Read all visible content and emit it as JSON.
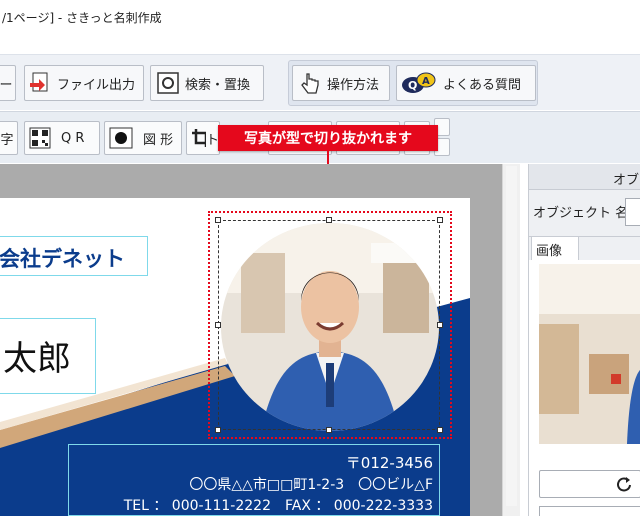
{
  "window": {
    "title": "/1ページ] - さきっと名刺作成"
  },
  "toolbar1": {
    "prev_label": "ー",
    "file_output_label": "ファイル出力",
    "search_replace_label": "検索・置換",
    "how_to_label": "操作方法",
    "faq_label": "よくある質問"
  },
  "toolbar2": {
    "char_label": "字",
    "qr_label": "Q R",
    "shape_label": "図 形",
    "trim_label": "ト"
  },
  "callout": {
    "text": "写真が型で切り抜かれます"
  },
  "card": {
    "company": "会社デネット",
    "name": "太郎",
    "postal": "〒012-3456",
    "address": "〇〇県△△市□□町1-2-3　〇〇ビル△F",
    "contact": "TEL ： 000-111-2222　FAX ： 000-222-3333"
  },
  "right_panel": {
    "header": "オブ",
    "object_name_label": "オブジェクト 名",
    "tab_image": "画像"
  },
  "colors": {
    "accent_red": "#e5081c",
    "card_navy": "#0b3c8c",
    "guide_cyan": "#7fd9ea"
  }
}
